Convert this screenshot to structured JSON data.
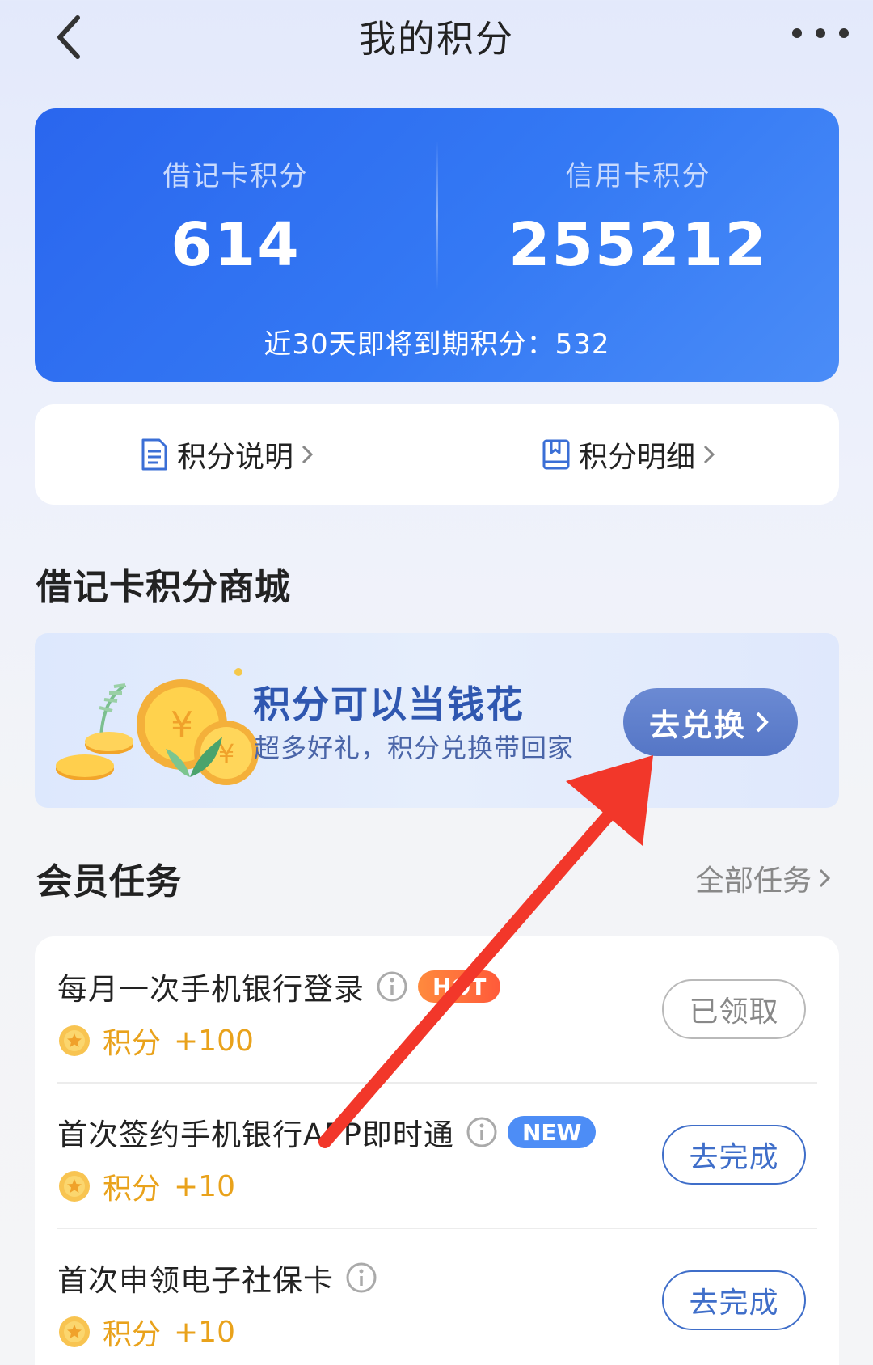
{
  "header": {
    "title": "我的积分",
    "back_icon": "chevron-left-icon",
    "more_icon": "more-dots-icon"
  },
  "points": {
    "debit_label": "借记卡积分",
    "debit_value": "614",
    "credit_label": "信用卡积分",
    "credit_value": "255212",
    "expiring_text": "近30天即将到期积分：532"
  },
  "links": {
    "explain_label": "积分说明",
    "explain_icon": "document-icon",
    "detail_label": "积分明细",
    "detail_icon": "book-icon"
  },
  "mall": {
    "title": "借记卡积分商城",
    "banner_title": "积分可以当钱花",
    "banner_subtitle": "超多好礼，积分兑换带回家",
    "redeem_label": "去兑换"
  },
  "tasks": {
    "title": "会员任务",
    "all_label": "全部任务",
    "items": [
      {
        "name": "每月一次手机银行登录",
        "badge": "HOT",
        "reward_label": "积分",
        "reward_value": "+100",
        "action": "已领取",
        "action_state": "done"
      },
      {
        "name": "首次签约手机银行APP即时通",
        "badge": "NEW",
        "reward_label": "积分",
        "reward_value": "+10",
        "action": "去完成",
        "action_state": "go"
      },
      {
        "name": "首次申领电子社保卡",
        "badge": "",
        "reward_label": "积分",
        "reward_value": "+10",
        "action": "去完成",
        "action_state": "go"
      }
    ]
  },
  "colors": {
    "card_blue": "#2f6ff2",
    "banner_title": "#2f57b0",
    "reward_orange": "#e9a21b",
    "annotation_red": "#f2372a"
  }
}
